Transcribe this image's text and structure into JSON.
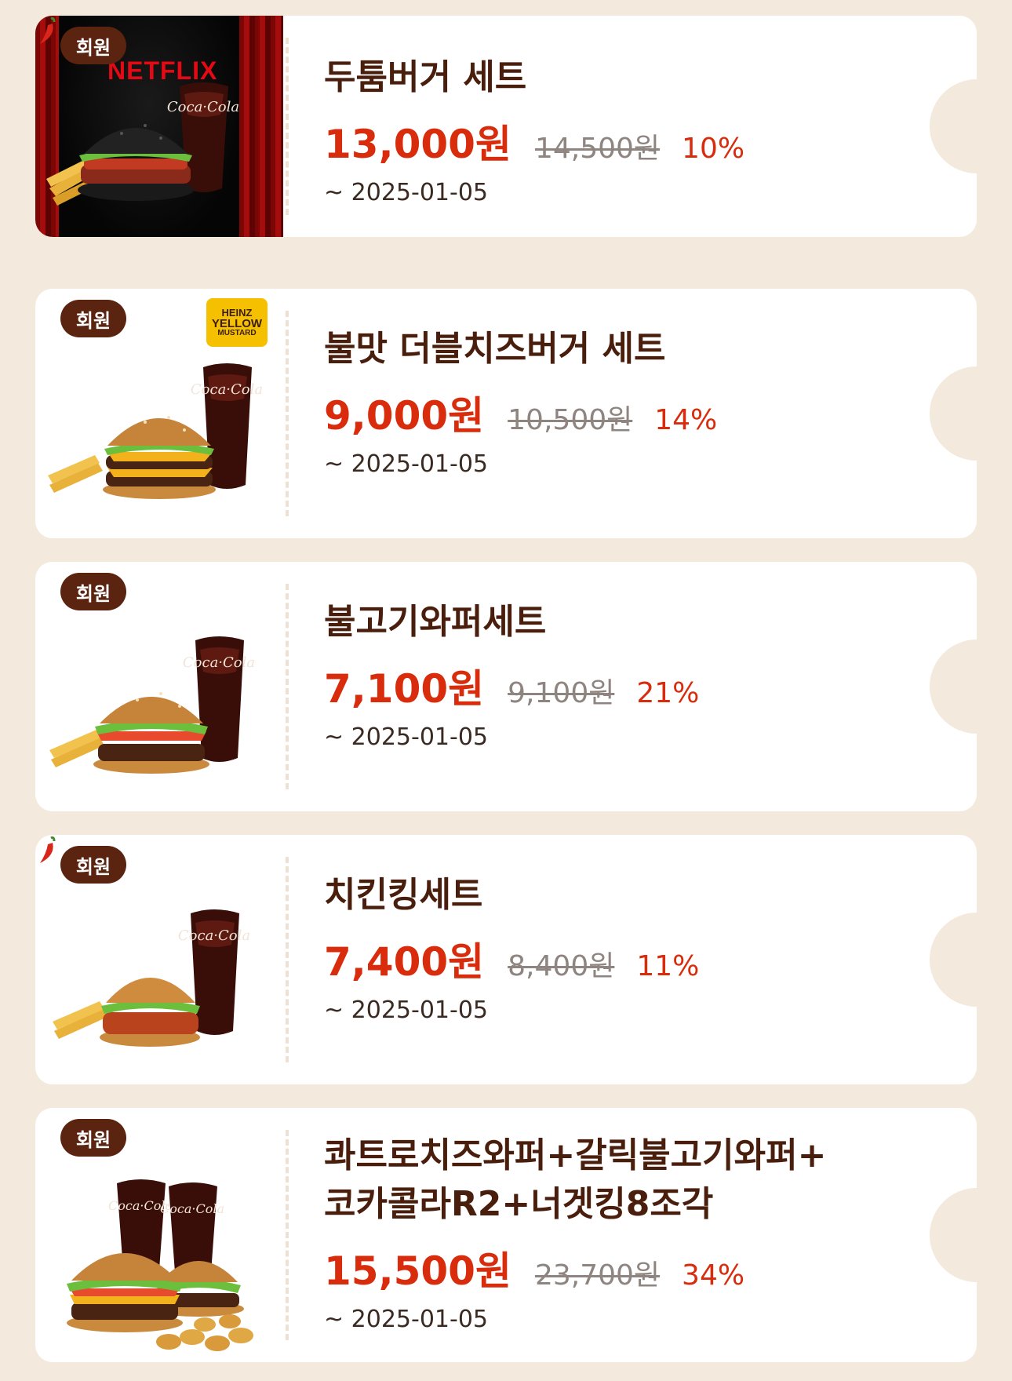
{
  "colors": {
    "background": "#f3e9dc",
    "card": "#ffffff",
    "title": "#4a1e0c",
    "price": "#d82c0d",
    "original_price": "#8f8580",
    "badge": "#5a2410"
  },
  "coupons": [
    {
      "badge": "회원",
      "name": "두툼버거 세트",
      "price": "13,000원",
      "original_price": "14,500원",
      "discount": "10%",
      "expire": "~ 2025-01-05",
      "image": {
        "burger": "black-bun-burger",
        "extras": [
          "fries",
          "coca-cola"
        ],
        "promo_logo": "NETFLIX",
        "spicy": true,
        "dark_background": true
      }
    },
    {
      "badge": "회원",
      "name": "불맛 더블치즈버거 세트",
      "price": "9,000원",
      "original_price": "10,500원",
      "discount": "14%",
      "expire": "~ 2025-01-05",
      "image": {
        "burger": "double-cheeseburger",
        "extras": [
          "fries",
          "coca-cola"
        ],
        "promo_logo": "HEINZ YELLOW MUSTARD",
        "spicy": false
      }
    },
    {
      "badge": "회원",
      "name": "불고기와퍼세트",
      "price": "7,100원",
      "original_price": "9,100원",
      "discount": "21%",
      "expire": "~ 2025-01-05",
      "image": {
        "burger": "whopper",
        "extras": [
          "fries",
          "coca-cola"
        ],
        "spicy": false
      }
    },
    {
      "badge": "회원",
      "name": "치킨킹세트",
      "price": "7,400원",
      "original_price": "8,400원",
      "discount": "11%",
      "expire": "~ 2025-01-05",
      "image": {
        "burger": "chicken-burger",
        "extras": [
          "fries",
          "coca-cola"
        ],
        "spicy": true
      }
    },
    {
      "badge": "회원",
      "name_line1": "콰트로치즈와퍼+갈릭불고기와퍼+",
      "name_line2": "코카콜라R2+너겟킹8조각",
      "price": "15,500원",
      "original_price": "23,700원",
      "discount": "34%",
      "expire": "~ 2025-01-05",
      "image": {
        "burger": "two-whoppers",
        "extras": [
          "nuggets",
          "coca-cola-x2"
        ],
        "spicy": false
      }
    }
  ],
  "mustard_logo": {
    "line1": "HEINZ",
    "line2": "YELLOW",
    "line3": "MUSTARD"
  },
  "netflix_logo": "NETFLIX"
}
